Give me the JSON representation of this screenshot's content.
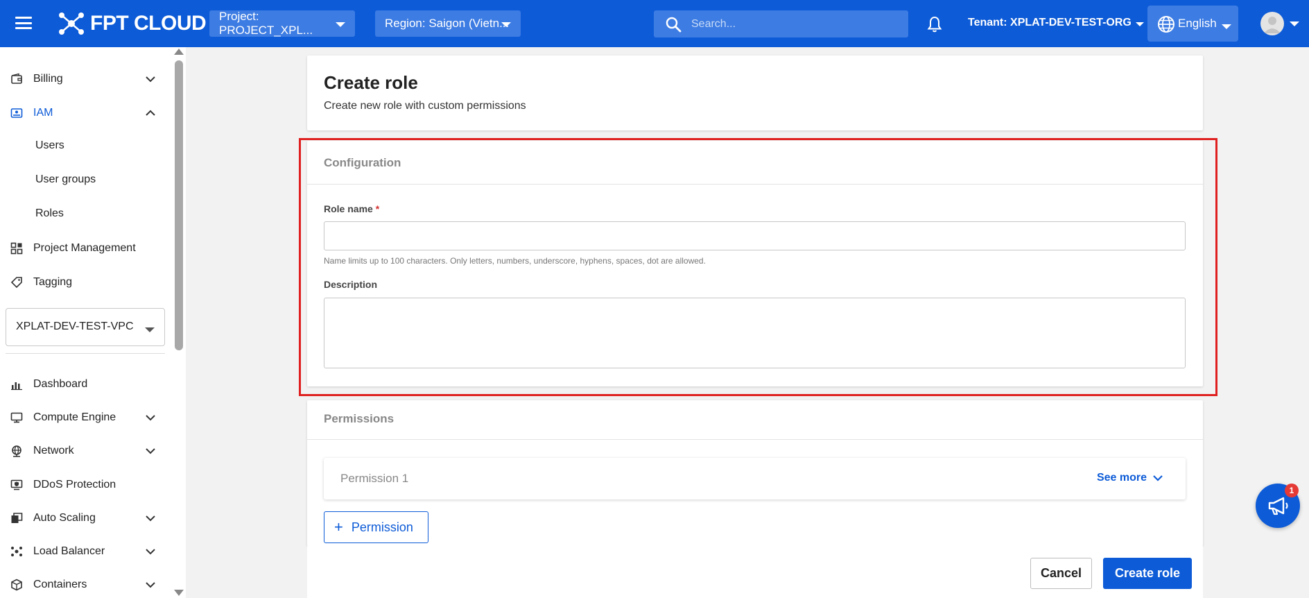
{
  "topbar": {
    "brand": "FPT CLOUD",
    "project_select": "Project: PROJECT_XPL...",
    "region_select": "Region: Saigon (Vietn...",
    "search_placeholder": "Search...",
    "tenant": "Tenant: XPLAT-DEV-TEST-ORG",
    "language": "English"
  },
  "sidebar": {
    "top_items": [
      {
        "label": "Billing",
        "icon": "wallet-icon"
      },
      {
        "label": "IAM",
        "icon": "id-card-icon"
      }
    ],
    "iam_subitems": [
      "Users",
      "User groups",
      "Roles"
    ],
    "mid_items": [
      {
        "label": "Project Management",
        "icon": "grid-plus-icon"
      },
      {
        "label": "Tagging",
        "icon": "tag-icon"
      }
    ],
    "vpc_select": "XPLAT-DEV-TEST-VPC",
    "bottom_items": [
      {
        "label": "Dashboard",
        "icon": "bar-chart-icon"
      },
      {
        "label": "Compute Engine",
        "icon": "monitor-icon"
      },
      {
        "label": "Network",
        "icon": "globe-network-icon"
      },
      {
        "label": "DDoS Protection",
        "icon": "shield-monitor-icon"
      },
      {
        "label": "Auto Scaling",
        "icon": "stack-icon"
      },
      {
        "label": "Load Balancer",
        "icon": "balance-icon"
      },
      {
        "label": "Containers",
        "icon": "box-icon"
      }
    ]
  },
  "header": {
    "title": "Create role",
    "subtitle": "Create new role with custom permissions"
  },
  "configuration": {
    "section_title": "Configuration",
    "role_name_label": "Role name",
    "required_mark": "*",
    "role_name_value": "",
    "role_name_hint": "Name limits up to 100 characters. Only letters, numbers, underscore, hyphens, spaces, dot are allowed.",
    "description_label": "Description",
    "description_value": ""
  },
  "permissions": {
    "section_title": "Permissions",
    "items": [
      {
        "label": "Permission 1",
        "see_more": "See more"
      }
    ],
    "add_button": "Permission"
  },
  "footer": {
    "cancel": "Cancel",
    "create": "Create role"
  },
  "notification_badge": "1",
  "colors": {
    "brand_blue": "#0d5bd7",
    "highlight_red": "#e02020"
  }
}
